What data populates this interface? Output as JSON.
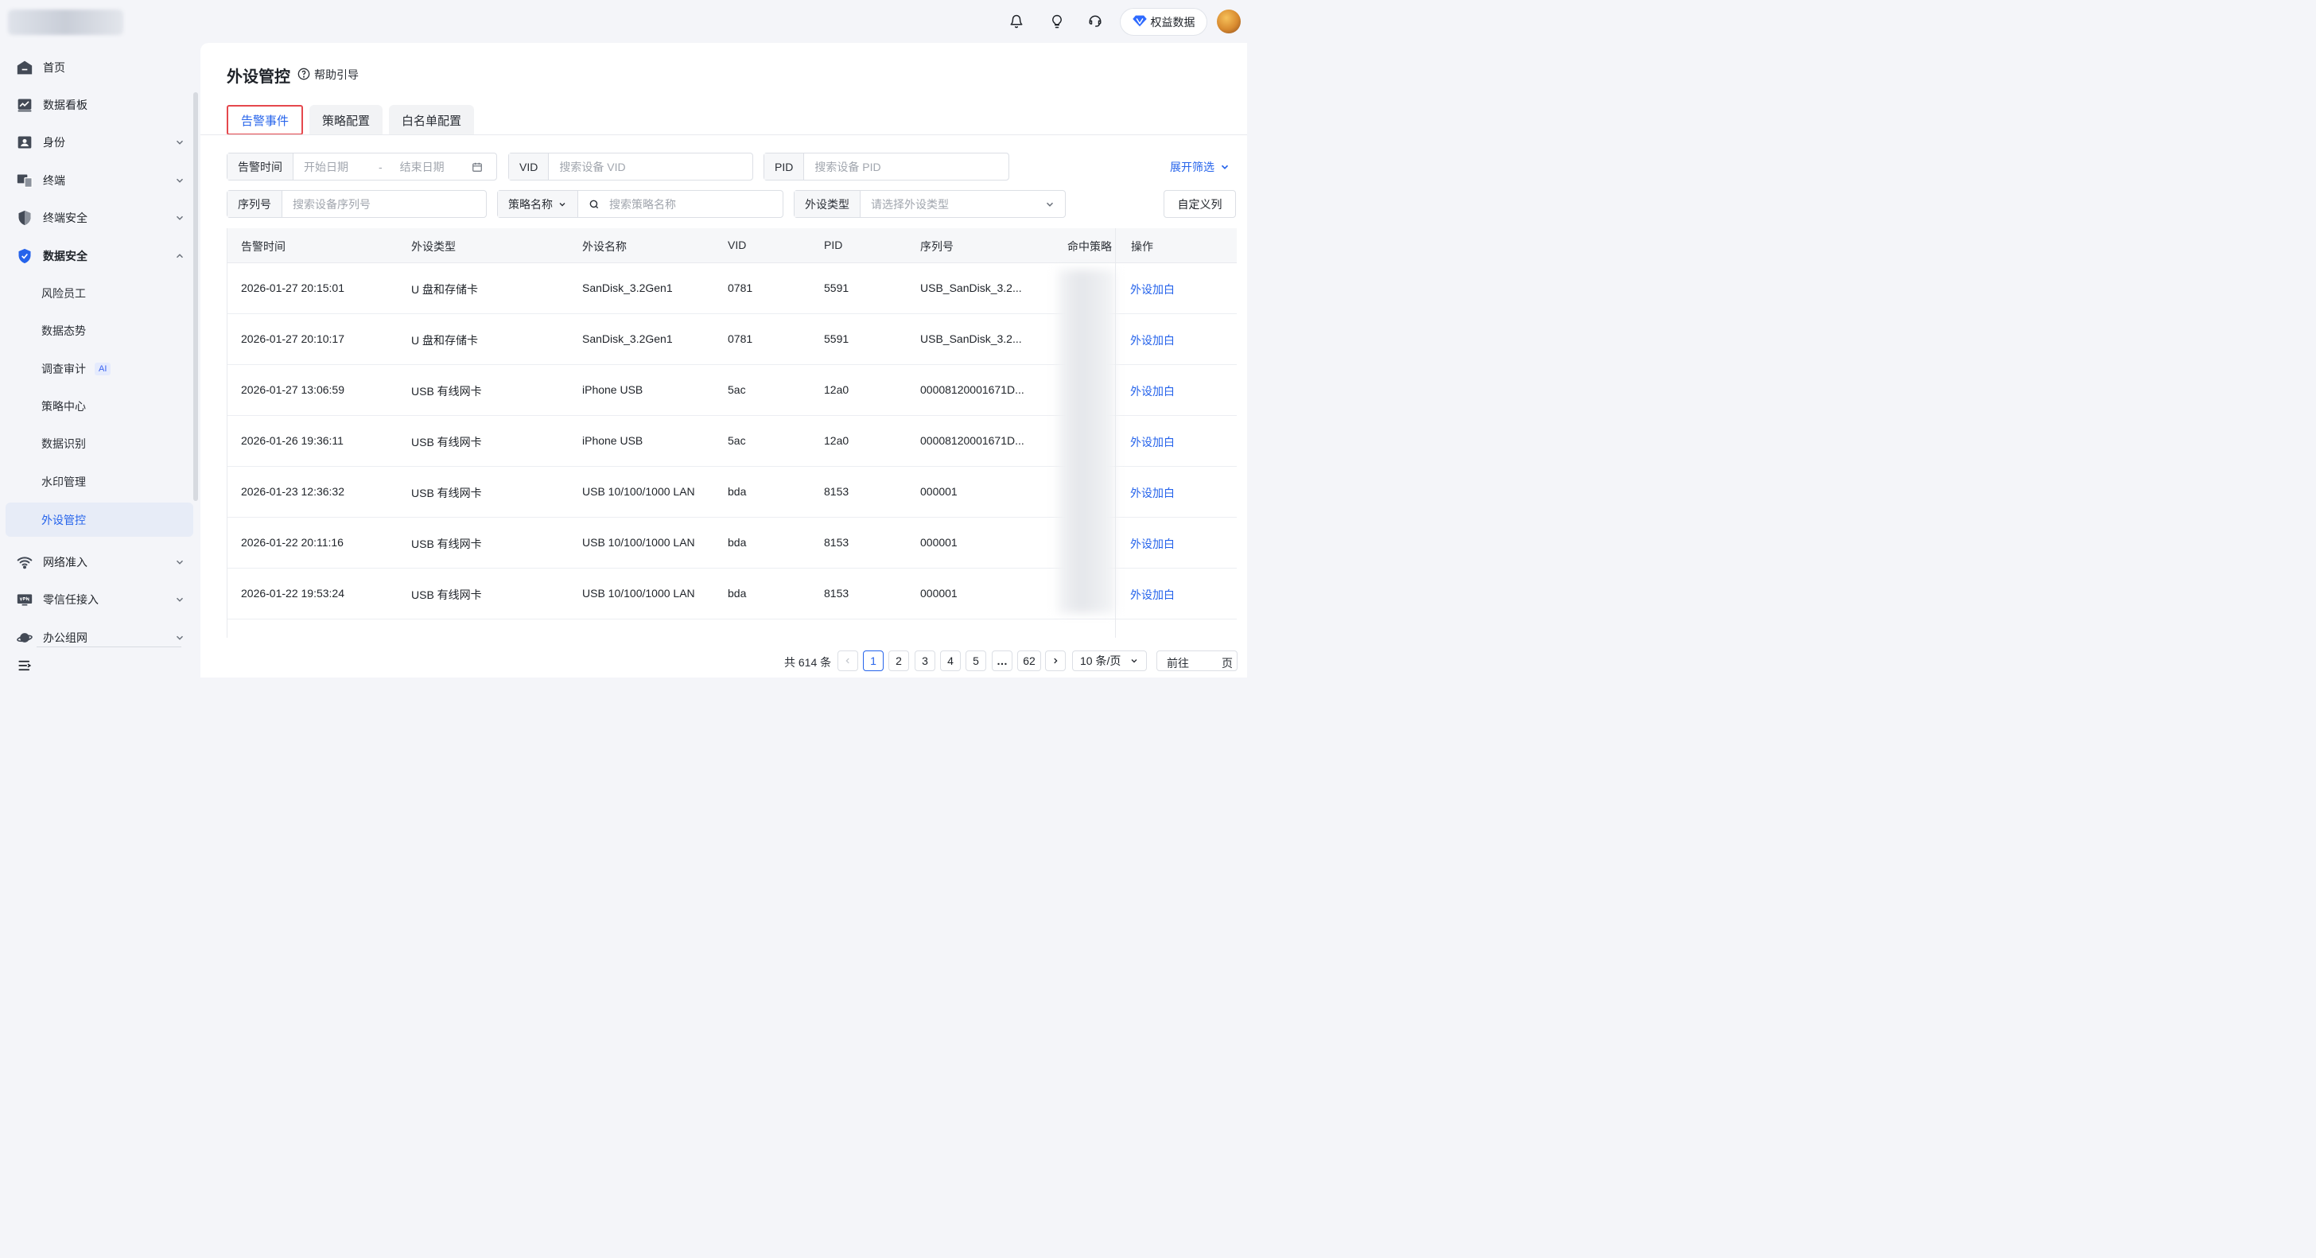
{
  "header": {
    "rights_label": "权益数据",
    "icons": [
      "bell-icon",
      "lightbulb-icon",
      "headset-icon",
      "diamond-icon"
    ]
  },
  "sidebar": {
    "items": [
      {
        "label": "首页",
        "icon": "home-icon"
      },
      {
        "label": "数据看板",
        "icon": "dashboard-icon"
      },
      {
        "label": "身份",
        "icon": "id-card-icon"
      },
      {
        "label": "终端",
        "icon": "devices-icon"
      },
      {
        "label": "终端安全",
        "icon": "shield-icon"
      },
      {
        "label": "数据安全",
        "icon": "data-security-icon",
        "expanded": true
      }
    ],
    "sub_items": [
      {
        "label": "风险员工"
      },
      {
        "label": "数据态势"
      },
      {
        "label": "调查审计",
        "badge": "AI"
      },
      {
        "label": "策略中心"
      },
      {
        "label": "数据识别"
      },
      {
        "label": "水印管理"
      },
      {
        "label": "外设管控",
        "active": true
      }
    ],
    "more_items": [
      {
        "label": "网络准入",
        "icon": "wifi-icon"
      },
      {
        "label": "零信任接入",
        "icon": "vpn-icon"
      },
      {
        "label": "办公组网",
        "icon": "planet-icon"
      }
    ]
  },
  "page": {
    "title": "外设管控",
    "help_label": "帮助引导",
    "tabs": [
      {
        "label": "告警事件",
        "active": true
      },
      {
        "label": "策略配置"
      },
      {
        "label": "白名单配置"
      }
    ]
  },
  "filters": {
    "alert_time_label": "告警时间",
    "start_date_placeholder": "开始日期",
    "date_separator": "-",
    "end_date_placeholder": "结束日期",
    "vid_label": "VID",
    "vid_placeholder": "搜索设备 VID",
    "pid_label": "PID",
    "pid_placeholder": "搜索设备 PID",
    "expand_label": "展开筛选",
    "serial_label": "序列号",
    "serial_placeholder": "搜索设备序列号",
    "policy_select_label": "策略名称",
    "policy_placeholder": "搜索策略名称",
    "device_type_label": "外设类型",
    "device_type_placeholder": "请选择外设类型",
    "custom_columns_label": "自定义列"
  },
  "table": {
    "columns": [
      "告警时间",
      "外设类型",
      "外设名称",
      "VID",
      "PID",
      "序列号",
      "命中策略",
      "操作"
    ],
    "rows": [
      {
        "time": "2026-01-27 20:15:01",
        "type": "U 盘和存储卡",
        "name": "SanDisk_3.2Gen1",
        "vid": "0781",
        "pid": "5591",
        "serial": "USB_SanDisk_3.2...",
        "action": "外设加白"
      },
      {
        "time": "2026-01-27 20:10:17",
        "type": "U 盘和存储卡",
        "name": "SanDisk_3.2Gen1",
        "vid": "0781",
        "pid": "5591",
        "serial": "USB_SanDisk_3.2...",
        "action": "外设加白"
      },
      {
        "time": "2026-01-27 13:06:59",
        "type": "USB 有线网卡",
        "name": "iPhone USB",
        "vid": "5ac",
        "pid": "12a0",
        "serial": "00008120001671D...",
        "action": "外设加白"
      },
      {
        "time": "2026-01-26 19:36:11",
        "type": "USB 有线网卡",
        "name": "iPhone USB",
        "vid": "5ac",
        "pid": "12a0",
        "serial": "00008120001671D...",
        "action": "外设加白"
      },
      {
        "time": "2026-01-23 12:36:32",
        "type": "USB 有线网卡",
        "name": "USB 10/100/1000 LAN",
        "vid": "bda",
        "pid": "8153",
        "serial": "000001",
        "action": "外设加白"
      },
      {
        "time": "2026-01-22 20:11:16",
        "type": "USB 有线网卡",
        "name": "USB 10/100/1000 LAN",
        "vid": "bda",
        "pid": "8153",
        "serial": "000001",
        "action": "外设加白"
      },
      {
        "time": "2026-01-22 19:53:24",
        "type": "USB 有线网卡",
        "name": "USB 10/100/1000 LAN",
        "vid": "bda",
        "pid": "8153",
        "serial": "000001",
        "action": "外设加白"
      }
    ]
  },
  "pagination": {
    "total_label": "共 614 条",
    "pages": [
      "1",
      "2",
      "3",
      "4",
      "5",
      "…",
      "62"
    ],
    "current": "1",
    "page_size_label": "10 条/页",
    "jump_prefix": "前往",
    "jump_suffix": "页"
  },
  "colors": {
    "accent": "#2563eb",
    "highlight_border": "#e5484d",
    "sidebar_active_bg": "#e7ecf7"
  }
}
